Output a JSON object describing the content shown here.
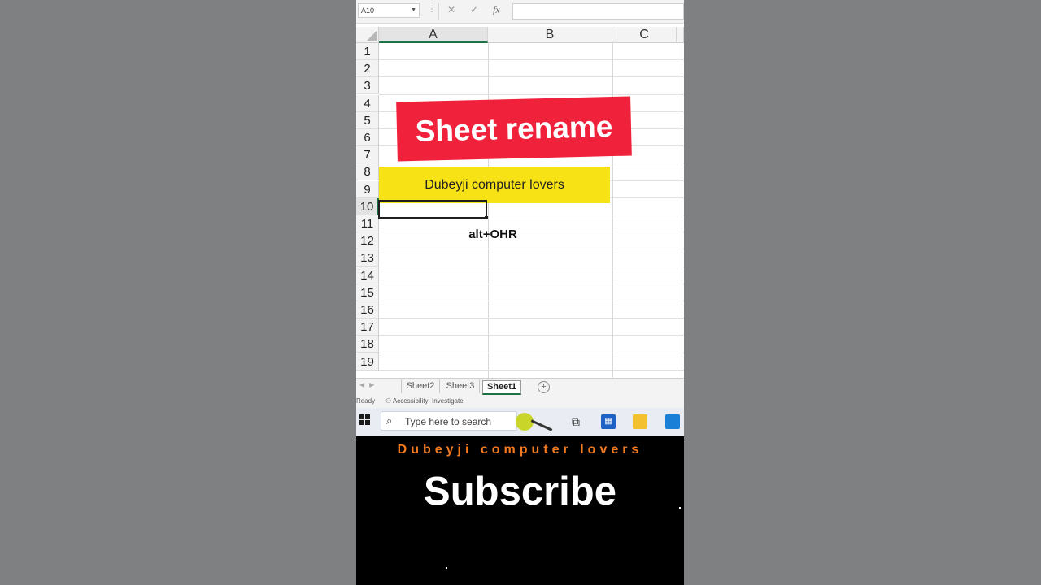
{
  "formula_bar": {
    "name_box": "A10",
    "cancel_glyph": "✕",
    "enter_glyph": "✓",
    "fx_glyph": "fx"
  },
  "columns": [
    "A",
    "B",
    "C"
  ],
  "rows": [
    "1",
    "2",
    "3",
    "4",
    "5",
    "6",
    "7",
    "8",
    "9",
    "10",
    "11",
    "12",
    "13",
    "14",
    "15",
    "16",
    "17",
    "18",
    "19"
  ],
  "overlay": {
    "banner": "Sheet rename",
    "yellow_box": "Dubeyji computer lovers",
    "shortcut": "alt+OHR"
  },
  "sheet_tabs": {
    "tabs": [
      "Sheet2",
      "Sheet3",
      "Sheet1"
    ],
    "active": "Sheet1"
  },
  "status_bar": {
    "ready": "Ready",
    "accessibility": "Accessibility: Investigate"
  },
  "taskbar": {
    "search_placeholder": "Type here to search"
  },
  "bottom": {
    "channel": "Dubeyji computer lovers",
    "subscribe": "Subscribe"
  },
  "colors": {
    "banner": "#f0213b",
    "yellow": "#f6e215",
    "channel_text": "#f47a1f",
    "excel_green": "#1e7145"
  },
  "icons": [
    "search-icon",
    "windows-start-icon",
    "task-view-icon",
    "store-icon",
    "file-explorer-icon",
    "mail-icon",
    "add-sheet-icon"
  ]
}
